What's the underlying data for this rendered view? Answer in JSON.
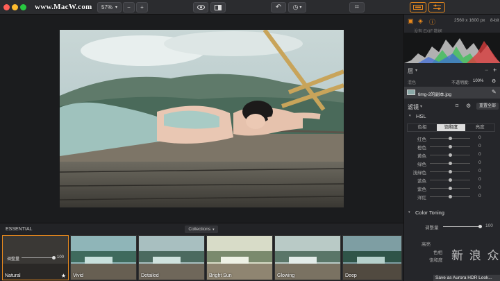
{
  "watermark": "www.MacW.com",
  "toolbar": {
    "zoom": "57%",
    "zoom_out": "−",
    "zoom_in": "+"
  },
  "colors": {
    "accent_orange": "#e8891d",
    "panel_bg": "#25262a",
    "toolbar_bg": "#2b2c2f"
  },
  "panel": {
    "image_size": "2560 x 1600 px",
    "bit_depth": "8-bit",
    "exif_note": "没有 EXIF 数据",
    "layers_title": "层",
    "blend_label": "混色",
    "opacity_label": "不透明度:",
    "opacity_value": "100%",
    "layer_name": "timg-2的副本.jpg",
    "filters_title": "滤镜",
    "reset_all": "重置全部",
    "hsl_title": "HSL",
    "hsl_tabs": [
      "色相",
      "饱和度",
      "亮度"
    ],
    "hsl_active_tab": "饱和度",
    "hsl_sliders": [
      {
        "name": "红色",
        "value": "0"
      },
      {
        "name": "橙色",
        "value": "0"
      },
      {
        "name": "黄色",
        "value": "0"
      },
      {
        "name": "绿色",
        "value": "0"
      },
      {
        "name": "浅绿色",
        "value": "0"
      },
      {
        "name": "蓝色",
        "value": "0"
      },
      {
        "name": "紫色",
        "value": "0"
      },
      {
        "name": "洋红",
        "value": "0"
      }
    ],
    "color_toning_title": "Color Toning",
    "adjust_label": "调整量",
    "adjust_value": "100",
    "highlights_label": "高亮",
    "hue_label": "色相",
    "sat_label": "饱和度"
  },
  "presets": {
    "section_title": "ESSENTIAL",
    "collections_label": "Collections",
    "amount_label": "调整量",
    "amount_value": "100",
    "items": [
      "Natural",
      "Vivid",
      "Detailed",
      "Bright Sun",
      "Glowing",
      "Deep"
    ],
    "selected": "Natural"
  },
  "overlay": {
    "tooltip": "Save as Aurora HDR Look...",
    "site_watermark": "新 浪 众 测"
  }
}
